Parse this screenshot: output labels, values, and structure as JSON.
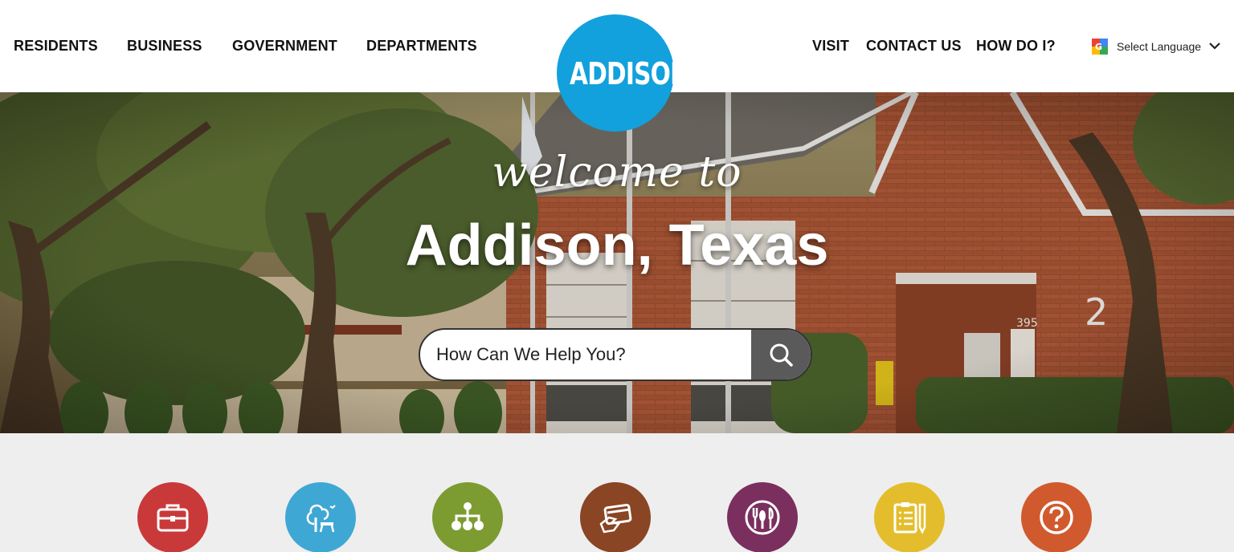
{
  "header": {
    "nav_left": [
      "RESIDENTS",
      "BUSINESS",
      "GOVERNMENT",
      "DEPARTMENTS"
    ],
    "nav_right": [
      "VISIT",
      "CONTACT US",
      "HOW DO I?"
    ],
    "logo_text": "ADDISON",
    "language": {
      "label": "Select Language",
      "icon": "google-translate-icon"
    }
  },
  "hero": {
    "welcome": "welcome to",
    "title": "Addison, Texas",
    "search": {
      "placeholder": "How Can We Help You?",
      "icon": "search-icon"
    }
  },
  "quick_links": [
    {
      "icon": "briefcase-icon",
      "color": "#c9393a"
    },
    {
      "icon": "park-tree-icon",
      "color": "#3fa7d4"
    },
    {
      "icon": "org-chart-icon",
      "color": "#7c9c32"
    },
    {
      "icon": "payment-card-icon",
      "color": "#8a4524"
    },
    {
      "icon": "dining-icon",
      "color": "#7a2f5e"
    },
    {
      "icon": "clipboard-icon",
      "color": "#e4bd2c"
    },
    {
      "icon": "help-question-icon",
      "color": "#d05a2e"
    }
  ],
  "colors": {
    "logo": "#12a1dc",
    "search_button": "#5a5a5a",
    "quick_bg": "#eeeeee"
  }
}
